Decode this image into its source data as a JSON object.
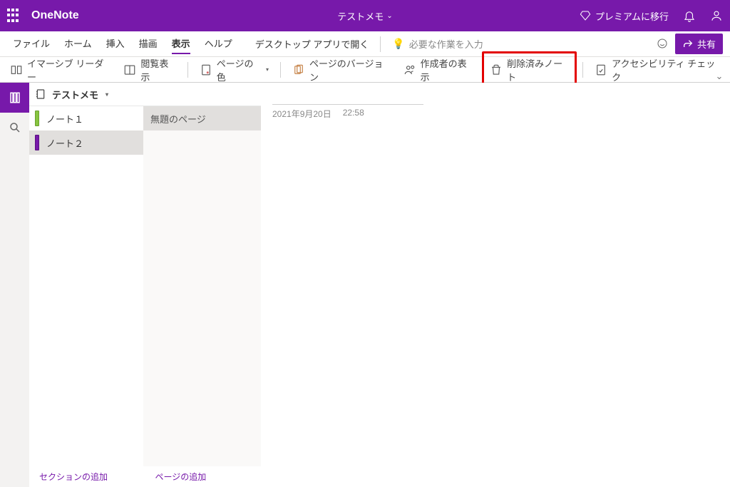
{
  "app_name": "OneNote",
  "notebook_title": "テストメモ",
  "premium_label": "プレミアムに移行",
  "share_label": "共有",
  "tabs": [
    "ファイル",
    "ホーム",
    "挿入",
    "描画",
    "表示",
    "ヘルプ"
  ],
  "active_tab_index": 4,
  "open_in_desktop": "デスクトップ アプリで開く",
  "tell_me_placeholder": "必要な作業を入力",
  "ribbon": {
    "immersive": "イマーシブ リーダー",
    "reading_view": "閲覧表示",
    "page_color": "ページの色",
    "page_versions": "ページのバージョン",
    "show_authors": "作成者の表示",
    "deleted_notes": "削除済みノート",
    "accessibility": "アクセシビリティ チェック"
  },
  "notebook_header": "テストメモ",
  "sections": [
    {
      "label": "ノート１",
      "color": "#87c440",
      "selected": false
    },
    {
      "label": "ノート２",
      "color": "#7719AA",
      "selected": true
    }
  ],
  "pages": [
    {
      "label": "無題のページ",
      "selected": true
    }
  ],
  "add_section": "セクションの追加",
  "add_page": "ページの追加",
  "canvas": {
    "date": "2021年9月20日",
    "time": "22:58"
  }
}
